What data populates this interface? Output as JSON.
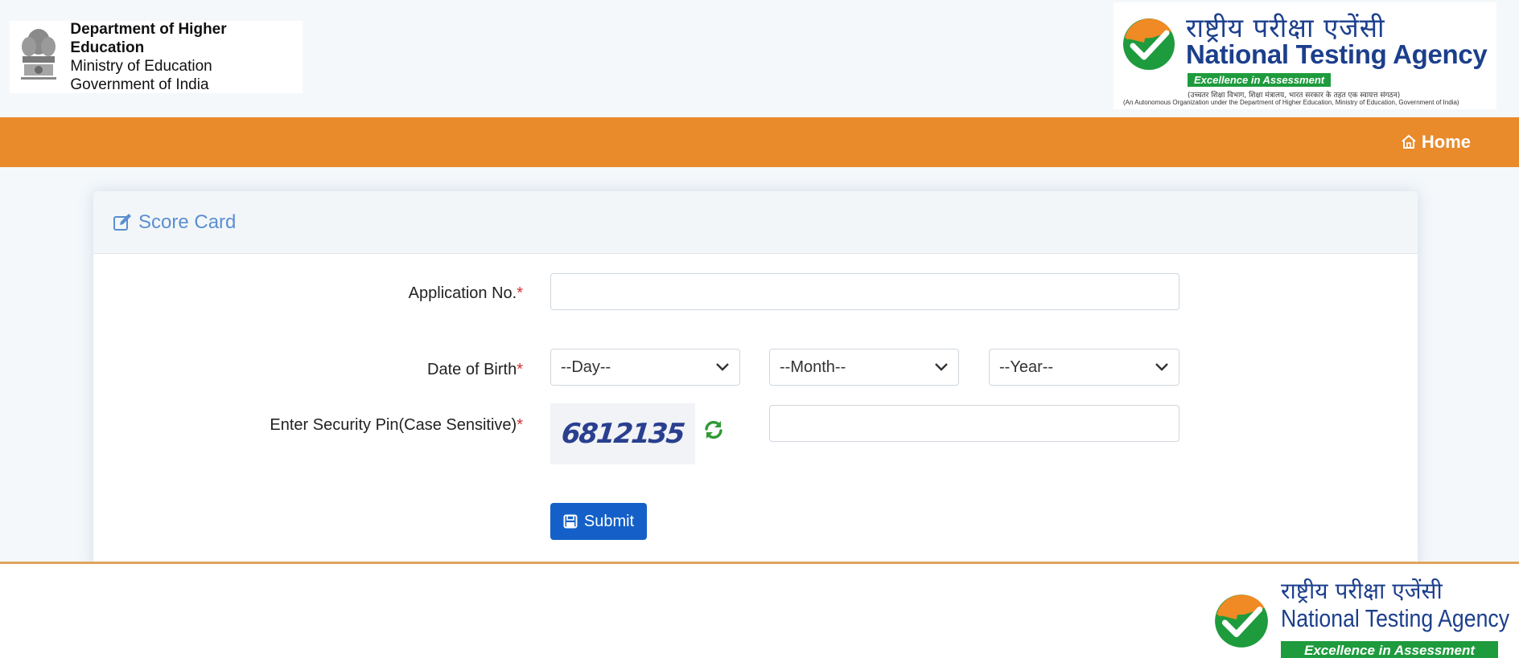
{
  "header": {
    "dhe": {
      "line1": "Department of Higher Education",
      "line2": "Ministry of Education",
      "line3": "Government of India",
      "emblem_caption": "सत्यमेव जयते"
    },
    "nta": {
      "hindi": "राष्ट्रीय परीक्षा एजेंसी",
      "english": "National Testing Agency",
      "tagline": "Excellence in Assessment",
      "sub_hindi": "(उच्चतर शिक्षा विभाग, शिक्षा मंत्रालय, भारत सरकार के तहत एक स्वायत्त संगठन)",
      "sub_english": "(An Autonomous Organization under the Department of Higher Education, Ministry of Education, Government of India)"
    }
  },
  "navbar": {
    "home_label": "Home",
    "bg_color": "#e98a2b"
  },
  "card": {
    "title": "Score Card",
    "title_icon": "edit-icon",
    "fields": {
      "application_no": {
        "label": "Application No.",
        "required_mark": "*",
        "value": ""
      },
      "dob": {
        "label": "Date of Birth",
        "required_mark": "*",
        "day": "--Day--",
        "month": "--Month--",
        "year": "--Year--"
      },
      "security_pin": {
        "label": "Enter Security Pin(Case Sensitive)",
        "required_mark": "*",
        "captcha_text": "6812135",
        "value": ""
      }
    },
    "submit_label": "Submit",
    "submit_color": "#1460c8"
  },
  "footer": {
    "hindi": "राष्ट्रीय परीक्षा एजेंसी",
    "english": "National Testing Agency",
    "tagline": "Excellence in Assessment"
  }
}
